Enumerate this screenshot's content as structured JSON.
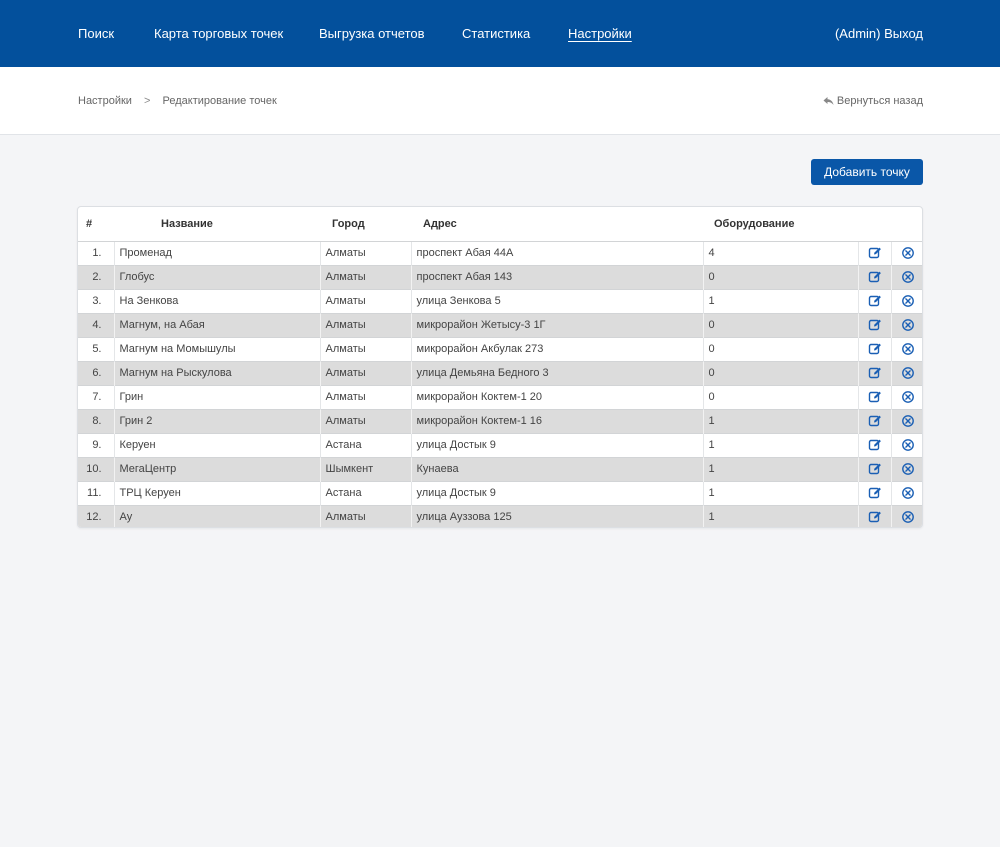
{
  "nav": {
    "items": [
      {
        "label": "Поиск",
        "active": false
      },
      {
        "label": "Карта торговых точек",
        "active": false
      },
      {
        "label": "Выгрузка отчетов",
        "active": false
      },
      {
        "label": "Статистика",
        "active": false
      },
      {
        "label": "Настройки",
        "active": true
      }
    ],
    "logout": "(Admin) Выход"
  },
  "breadcrumb": {
    "items": [
      "Настройки",
      "Редактирование точек"
    ],
    "separator": ">",
    "back": "Вернуться назад"
  },
  "toolbar": {
    "add_label": "Добавить точку"
  },
  "table": {
    "headers": {
      "num": "#",
      "name": "Название",
      "city": "Город",
      "address": "Адрес",
      "equipment": "Оборудование"
    },
    "rows": [
      {
        "num": "1.",
        "name": "Променад",
        "city": "Алматы",
        "address": "проспект Абая 44А",
        "equipment": "4"
      },
      {
        "num": "2.",
        "name": "Глобус",
        "city": "Алматы",
        "address": "проспект Абая 143",
        "equipment": "0"
      },
      {
        "num": "3.",
        "name": "На Зенкова",
        "city": "Алматы",
        "address": "улица Зенкова 5",
        "equipment": "1"
      },
      {
        "num": "4.",
        "name": "Магнум, на Абая",
        "city": "Алматы",
        "address": "микрорайон Жетысу-3 1Г",
        "equipment": "0"
      },
      {
        "num": "5.",
        "name": "Магнум на Момышулы",
        "city": "Алматы",
        "address": "микрорайон Акбулак 273",
        "equipment": "0"
      },
      {
        "num": "6.",
        "name": "Магнум на Рыскулова",
        "city": "Алматы",
        "address": "улица Демьяна Бедного 3",
        "equipment": "0"
      },
      {
        "num": "7.",
        "name": "Грин",
        "city": "Алматы",
        "address": "микрорайон Коктем-1 20",
        "equipment": "0"
      },
      {
        "num": "8.",
        "name": "Грин 2",
        "city": "Алматы",
        "address": "микрорайон Коктем-1 16",
        "equipment": "1"
      },
      {
        "num": "9.",
        "name": "Керуен",
        "city": "Астана",
        "address": "улица Достык 9",
        "equipment": "1"
      },
      {
        "num": "10.",
        "name": "МегаЦентр",
        "city": "Шымкент",
        "address": "Кунаева",
        "equipment": "1"
      },
      {
        "num": "11.",
        "name": "ТРЦ Керуен",
        "city": "Астана",
        "address": "улица Достык 9",
        "equipment": "1"
      },
      {
        "num": "12.",
        "name": "Ау",
        "city": "Алматы",
        "address": "улица Ауззова 125",
        "equipment": "1"
      }
    ],
    "row_actions": [
      {
        "icon": "edit-icon",
        "color": "#1a5fb4"
      },
      {
        "icon": "delete-icon",
        "color": "#1a5fb4"
      }
    ]
  },
  "colors": {
    "nav_bg": "#03509c",
    "button_bg": "#0a57a8",
    "row_alt_bg": "#dcdcdc",
    "page_bg": "#f4f5f7"
  }
}
